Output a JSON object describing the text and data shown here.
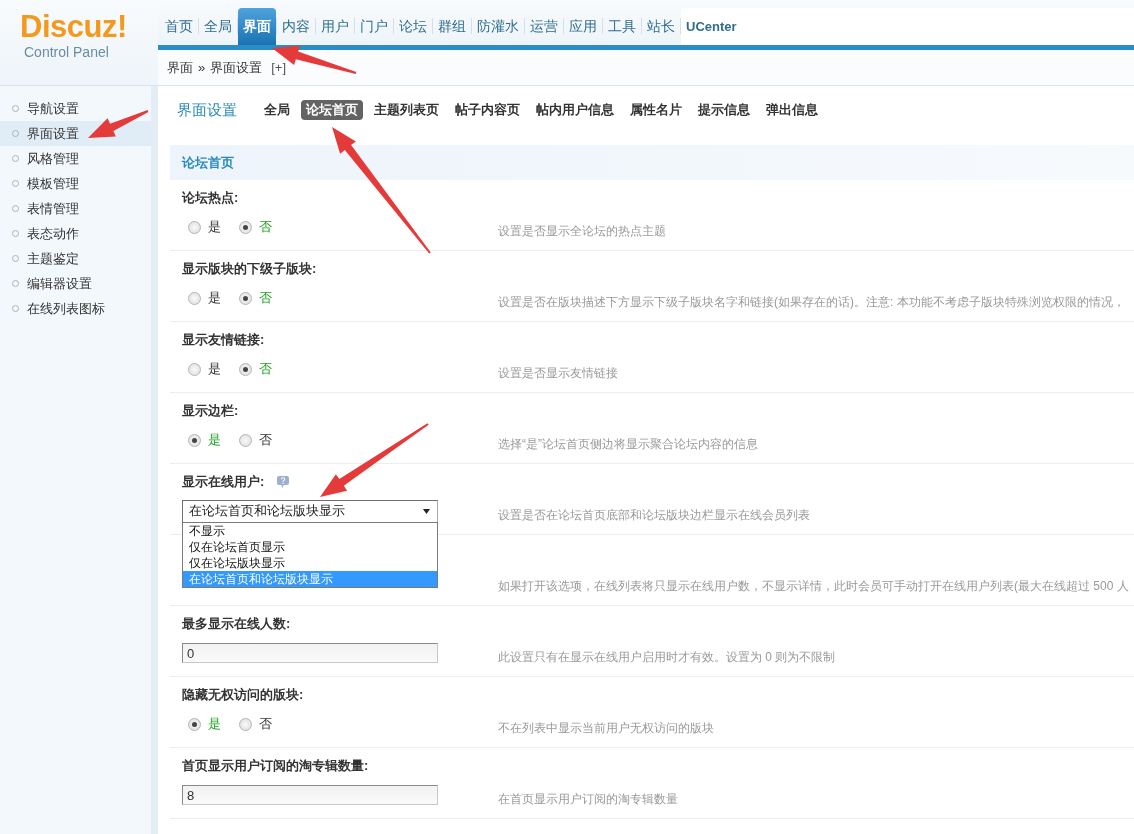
{
  "logo": {
    "title": "Discuz!",
    "subtitle": "Control Panel"
  },
  "top_nav": [
    {
      "label": "首页",
      "kind": "menu",
      "selected": false
    },
    {
      "label": "全局",
      "kind": "menu",
      "selected": false
    },
    {
      "label": "界面",
      "kind": "menu",
      "selected": true
    },
    {
      "label": "内容",
      "kind": "menu",
      "selected": false
    },
    {
      "label": "用户",
      "kind": "menu",
      "selected": false
    },
    {
      "label": "门户",
      "kind": "menu",
      "selected": false
    },
    {
      "label": "论坛",
      "kind": "menu",
      "selected": false
    },
    {
      "label": "群组",
      "kind": "menu",
      "selected": false
    },
    {
      "label": "防灌水",
      "kind": "menu",
      "selected": false
    },
    {
      "label": "运营",
      "kind": "menu",
      "selected": false
    },
    {
      "label": "应用",
      "kind": "menu",
      "selected": false
    },
    {
      "label": "工具",
      "kind": "menu",
      "selected": false
    },
    {
      "label": "站长",
      "kind": "menu",
      "selected": false
    },
    {
      "label": "UCenter",
      "kind": "app",
      "selected": false
    }
  ],
  "breadcrumb": {
    "items": [
      "界面",
      "界面设置"
    ],
    "separator": "»",
    "add_button": "[+]"
  },
  "sidebar": {
    "items": [
      {
        "label": "导航设置",
        "selected": false
      },
      {
        "label": "界面设置",
        "selected": true
      },
      {
        "label": "风格管理",
        "selected": false
      },
      {
        "label": "模板管理",
        "selected": false
      },
      {
        "label": "表情管理",
        "selected": false
      },
      {
        "label": "表态动作",
        "selected": false
      },
      {
        "label": "主题鉴定",
        "selected": false
      },
      {
        "label": "编辑器设置",
        "selected": false
      },
      {
        "label": "在线列表图标",
        "selected": false
      }
    ]
  },
  "page": {
    "title": "界面设置",
    "tabs": [
      {
        "label": "全局",
        "selected": false
      },
      {
        "label": "论坛首页",
        "selected": true
      },
      {
        "label": "主题列表页",
        "selected": false
      },
      {
        "label": "帖子内容页",
        "selected": false
      },
      {
        "label": "帖内用户信息",
        "selected": false
      },
      {
        "label": "属性名片",
        "selected": false
      },
      {
        "label": "提示信息",
        "selected": false
      },
      {
        "label": "弹出信息",
        "selected": false
      }
    ],
    "section_title": "论坛首页",
    "rows": [
      {
        "kind": "radio",
        "label": "论坛热点:",
        "options": [
          {
            "label": "是",
            "selected": false
          },
          {
            "label": "否",
            "selected": true
          }
        ],
        "description": "设置是否显示全论坛的热点主题"
      },
      {
        "kind": "radio",
        "label": "显示版块的下级子版块:",
        "options": [
          {
            "label": "是",
            "selected": false
          },
          {
            "label": "否",
            "selected": true
          }
        ],
        "description": "设置是否在版块描述下方显示下级子版块名字和链接(如果存在的话)。注意: 本功能不考虑子版块特殊浏览权限的情况，"
      },
      {
        "kind": "radio",
        "label": "显示友情链接:",
        "options": [
          {
            "label": "是",
            "selected": false
          },
          {
            "label": "否",
            "selected": true
          }
        ],
        "description": "设置是否显示友情链接"
      },
      {
        "kind": "radio",
        "label": "显示边栏:",
        "options": [
          {
            "label": "是",
            "selected": true
          },
          {
            "label": "否",
            "selected": false
          }
        ],
        "description": "选择“是”论坛首页侧边将显示聚合论坛内容的信息"
      },
      {
        "kind": "select",
        "label": "显示在线用户:",
        "help": true,
        "value": "在论坛首页和论坛版块显示",
        "expanded": true,
        "options": [
          {
            "label": "不显示",
            "selected": false
          },
          {
            "label": "仅在论坛首页显示",
            "selected": false
          },
          {
            "label": "仅在论坛版块显示",
            "selected": false
          },
          {
            "label": "在论坛首页和论坛版块显示",
            "selected": true
          }
        ],
        "description": "设置是否在论坛首页底部和论坛版块边栏显示在线会员列表"
      },
      {
        "kind": "covered",
        "description": "如果打开该选项，在线列表将只显示在线用户数，不显示详情，此时会员可手动打开在线用户列表(最大在线超过 500 人"
      },
      {
        "kind": "input",
        "label": "最多显示在线人数:",
        "value": "0",
        "description": "此设置只有在显示在线用户启用时才有效。设置为 0 则为不限制"
      },
      {
        "kind": "radio",
        "label": "隐藏无权访问的版块:",
        "options": [
          {
            "label": "是",
            "selected": true
          },
          {
            "label": "否",
            "selected": false
          }
        ],
        "description": "不在列表中显示当前用户无权访问的版块"
      },
      {
        "kind": "input",
        "label": "首页显示用户订阅的淘专辑数量:",
        "value": "8",
        "description": "在首页显示用户订阅的淘专辑数量"
      }
    ]
  }
}
